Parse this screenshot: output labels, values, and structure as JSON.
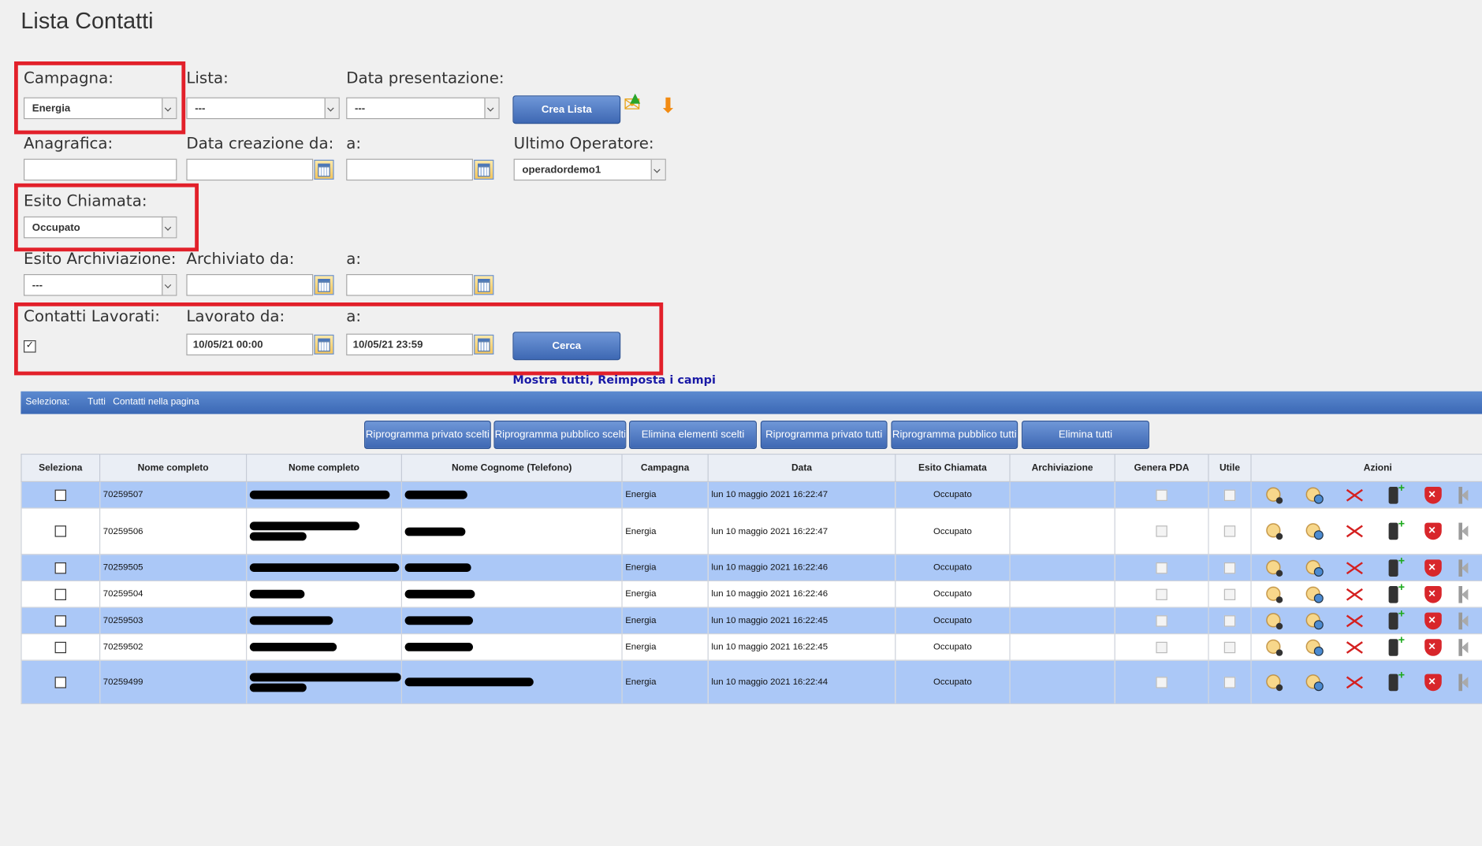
{
  "page_title": "Lista Contatti",
  "filters": {
    "campagna_label": "Campagna:",
    "campagna_value": "Energia",
    "lista_label": "Lista:",
    "lista_value": "---",
    "data_presentazione_label": "Data presentazione:",
    "data_presentazione_value": "---",
    "crea_lista_button": "Crea Lista",
    "anagrafica_label": "Anagrafica:",
    "data_creazione_da_label": "Data creazione da:",
    "a_label": "a:",
    "ultimo_operatore_label": "Ultimo Operatore:",
    "ultimo_operatore_value": "operadordemo1",
    "esito_chiamata_label": "Esito Chiamata:",
    "esito_chiamata_value": "Occupato",
    "esito_archiviazione_label": "Esito Archiviazione:",
    "esito_archiviazione_value": "---",
    "archiviato_da_label": "Archiviato da:",
    "contatti_lavorati_label": "Contatti Lavorati:",
    "contatti_lavorati_checked": true,
    "lavorato_da_label": "Lavorato da:",
    "lavorato_da_value": "10/05/21 00:00",
    "lavorato_a_value": "10/05/21 23:59",
    "cerca_button": "Cerca",
    "mostra_tutti_link": "Mostra tutti,",
    "reimposta_link": "Reimposta i campi"
  },
  "selection_bar": {
    "label": "Seleziona:",
    "tutti": "Tutti",
    "contatti_pagina": "Contatti nella pagina"
  },
  "action_buttons": [
    "Riprogramma privato scelti",
    "Riprogramma pubblico scelti",
    "Elimina elementi scelti",
    "Riprogramma privato tutti",
    "Riprogramma pubblico tutti",
    "Elimina tutti"
  ],
  "table": {
    "headers": [
      "Seleziona",
      "Nome completo",
      "Nome completo",
      "Nome Cognome (Telefono)",
      "Campagna",
      "Data",
      "Esito Chiamata",
      "Archiviazione",
      "Genera PDA",
      "Utile",
      "Azioni"
    ],
    "rows": [
      {
        "id": "70259507",
        "campagna": "Energia",
        "data": "lun 10 maggio 2021 16:22:47",
        "esito": "Occupato"
      },
      {
        "id": "70259506",
        "campagna": "Energia",
        "data": "lun 10 maggio 2021 16:22:47",
        "esito": "Occupato"
      },
      {
        "id": "70259505",
        "campagna": "Energia",
        "data": "lun 10 maggio 2021 16:22:46",
        "esito": "Occupato"
      },
      {
        "id": "70259504",
        "campagna": "Energia",
        "data": "lun 10 maggio 2021 16:22:46",
        "esito": "Occupato"
      },
      {
        "id": "70259503",
        "campagna": "Energia",
        "data": "lun 10 maggio 2021 16:22:45",
        "esito": "Occupato"
      },
      {
        "id": "70259502",
        "campagna": "Energia",
        "data": "lun 10 maggio 2021 16:22:45",
        "esito": "Occupato"
      },
      {
        "id": "70259499",
        "campagna": "Energia",
        "data": "lun 10 maggio 2021 16:22:44",
        "esito": "Occupato"
      }
    ]
  },
  "colors": {
    "highlight_box": "#e2202a",
    "row_blue": "#abc8f7",
    "button_blue": "#3e68b3",
    "link": "#1a1aa6"
  },
  "icons": [
    "user-call-icon",
    "group-call-icon",
    "delete-x-icon",
    "phone-add-icon",
    "block-shield-icon",
    "speaker-icon",
    "upload-mail-icon",
    "download-icon",
    "calendar-icon"
  ]
}
